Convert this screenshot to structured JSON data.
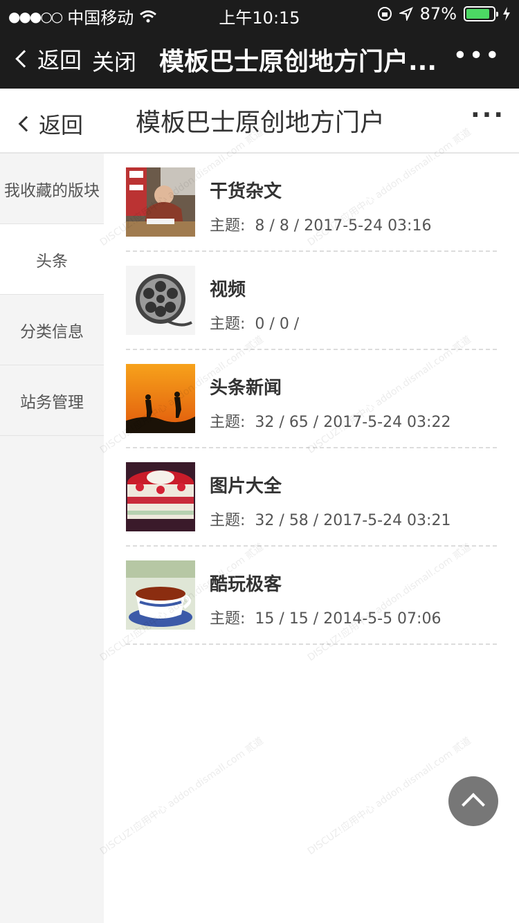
{
  "status_bar": {
    "carrier": "中国移动",
    "time": "上午10:15",
    "battery": "87%",
    "battery_level": 0.87
  },
  "wechat_bar": {
    "back_label": "返回",
    "close_label": "关闭",
    "title": "模板巴士原创地方门户...",
    "more_label": "•••"
  },
  "header": {
    "back_label": "返回",
    "title": "模板巴士原创地方门户",
    "more_label": "···"
  },
  "sidebar": {
    "items": [
      {
        "label": "我收藏的版块"
      },
      {
        "label": "头条"
      },
      {
        "label": "分类信息"
      },
      {
        "label": "站务管理"
      }
    ]
  },
  "forums": [
    {
      "name": "干货杂文",
      "meta_label": "主题:",
      "stats": "8 / 8 / 2017-5-24 03:16",
      "icon": "office-photo"
    },
    {
      "name": "视频",
      "meta_label": "主题:",
      "stats": "0 / 0 /",
      "icon": "film-reel"
    },
    {
      "name": "头条新闻",
      "meta_label": "主题:",
      "stats": "32 / 65 / 2017-5-24 03:22",
      "icon": "hikers-sunset"
    },
    {
      "name": "图片大全",
      "meta_label": "主题:",
      "stats": "32 / 58 / 2017-5-24 03:21",
      "icon": "strawberry-cake"
    },
    {
      "name": "酷玩极客",
      "meta_label": "主题:",
      "stats": "15 / 15 / 2014-5-5 07:06",
      "icon": "tea-cup"
    }
  ],
  "watermark": "DISCUZ!应用中心 addon.dismall.com 贰道"
}
